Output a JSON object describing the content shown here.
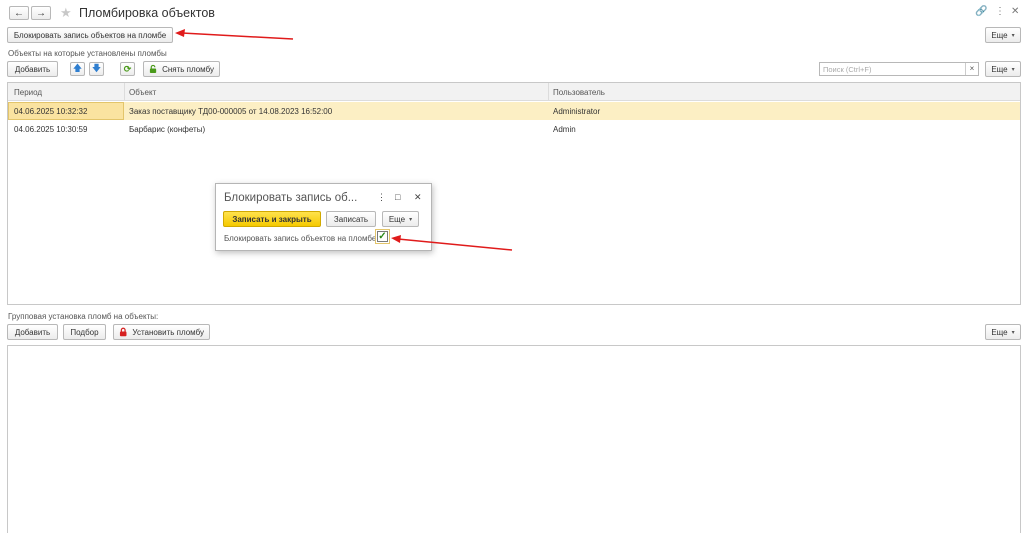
{
  "header": {
    "title": "Пломбировка объектов",
    "back_icon": "←",
    "forward_icon": "→",
    "star_icon": "★",
    "link_icon": "🔗",
    "more_icon": "⋮",
    "close_icon": "✕"
  },
  "toolbar_top": {
    "block_label": "Блокировать запись объектов на пломбе",
    "more_label": "Еще"
  },
  "sealed_section": {
    "title": "Объекты на которые установлены пломбы",
    "add_label": "Добавить",
    "up_icon": "🡅",
    "down_icon": "🡇",
    "refresh_icon": "⟳",
    "remove_seal_label": "Снять пломбу",
    "search_placeholder": "Поиск (Ctrl+F)",
    "search_clear": "×",
    "more_label": "Еще",
    "columns": [
      "Период",
      "Объект",
      "Пользователь"
    ],
    "rows": [
      {
        "period": "04.06.2025 10:32:32",
        "object": "Заказ поставщику ТД00-000005 от 14.08.2023 16:52:00",
        "user": "Administrator"
      },
      {
        "period": "04.06.2025 10:30:59",
        "object": "Барбарис (конфеты)",
        "user": "Admin"
      }
    ]
  },
  "dialog": {
    "title": "Блокировать запись об...",
    "more_icon": "⋮",
    "maximize_icon": "□",
    "close_icon": "✕",
    "save_close_label": "Записать и закрыть",
    "save_label": "Записать",
    "more_label": "Еще",
    "checkbox_label": "Блокировать запись объектов на пломбе:",
    "checkbox_checked": true,
    "check_mark": "✓"
  },
  "group_section": {
    "title": "Групповая установка пломб на объекты:",
    "add_label": "Добавить",
    "pick_label": "Подбор",
    "set_seal_label": "Установить пломбу",
    "more_label": "Еще"
  },
  "colors": {
    "accent_yellow": "#f5c900",
    "selected_row": "#fcefc4",
    "annotation_arrow": "#e01b1b",
    "lock_red": "#d62020",
    "unlock_green": "#4a9a1a",
    "arrow_blue": "#2f7fd0"
  }
}
